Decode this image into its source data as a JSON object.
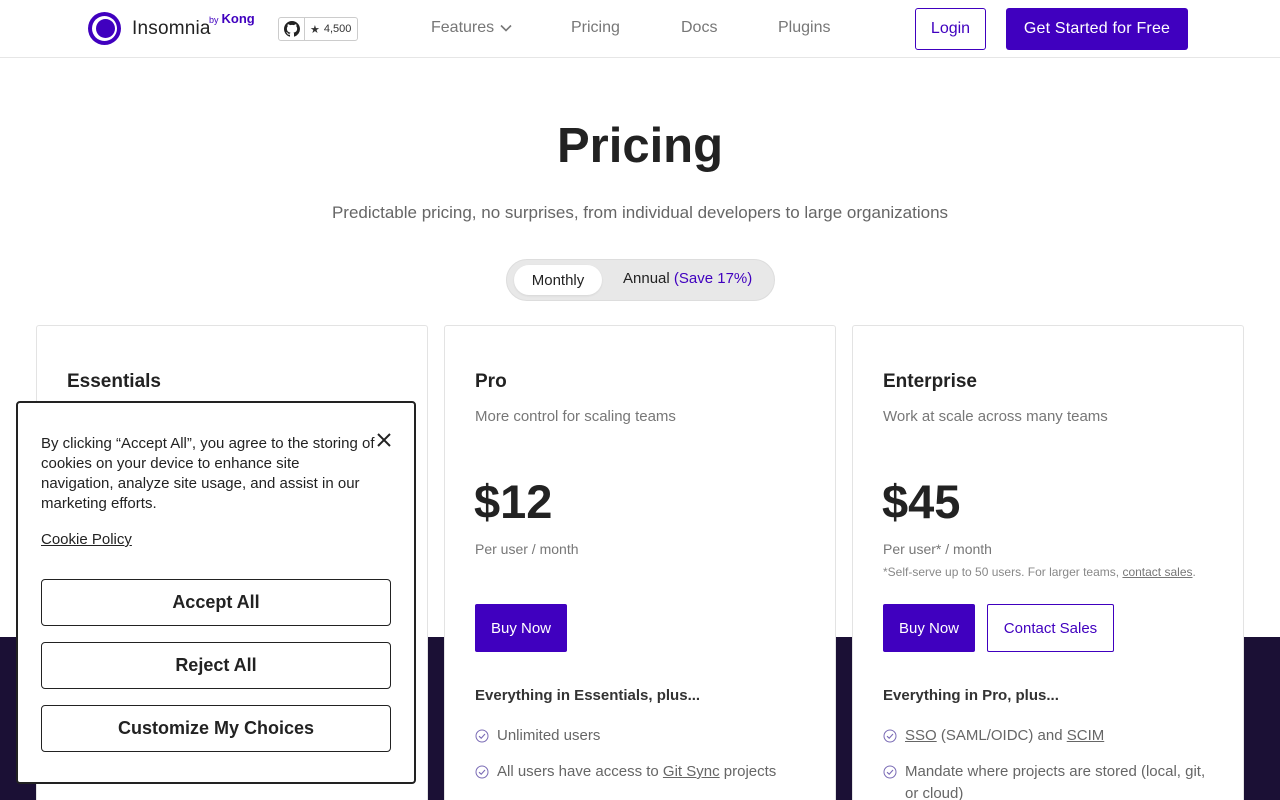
{
  "header": {
    "brand": "Insomnia",
    "brand_by": "by",
    "brand_kong": "Kong",
    "github_stars": "4,500",
    "nav": {
      "features": "Features",
      "pricing": "Pricing",
      "docs": "Docs",
      "plugins": "Plugins"
    },
    "login_label": "Login",
    "get_started_label": "Get Started for Free"
  },
  "hero": {
    "title": "Pricing",
    "subtitle": "Predictable pricing, no surprises, from individual developers to large organizations",
    "toggle": {
      "monthly": "Monthly",
      "annual": "Annual",
      "save": "(Save 17%)"
    }
  },
  "plans": {
    "essentials": {
      "name": "Essentials"
    },
    "pro": {
      "name": "Pro",
      "desc": "More control for scaling teams",
      "price": "$12",
      "per": "Per user / month",
      "buy_label": "Buy Now",
      "plus": "Everything in Essentials, plus...",
      "features": {
        "f1": "Unlimited users",
        "f2_pre": "All users have access to",
        "f2_link": "Git Sync",
        "f2_post": "projects"
      }
    },
    "enterprise": {
      "name": "Enterprise",
      "desc": "Work at scale across many teams",
      "price": "$45",
      "per": "Per user* / month",
      "note_pre": "*Self-serve up to 50 users. For larger teams,",
      "note_link": "contact sales",
      "note_post": ".",
      "buy_label": "Buy Now",
      "contact_label": "Contact Sales",
      "plus": "Everything in Pro, plus...",
      "features": {
        "f1_link1": "SSO",
        "f1_mid": "(SAML/OIDC) and",
        "f1_link2": "SCIM",
        "f2": "Mandate where projects are stored (local, git, or cloud)"
      }
    }
  },
  "cookie": {
    "text": "By clicking “Accept All”, you agree to the storing of cookies on your device to enhance site navigation, analyze site usage, and assist in our marketing efforts.",
    "policy_label": "Cookie Policy",
    "accept_label": "Accept All",
    "reject_label": "Reject All",
    "customize_label": "Customize My Choices"
  },
  "colors": {
    "brand": "#4000bf",
    "dark_band": "#1b1035"
  },
  "icons": {
    "logo": "insomnia-logo-icon",
    "github": "github-icon",
    "star": "star-icon",
    "chevron": "chevron-down-icon",
    "check": "check-circle-icon",
    "close": "close-icon"
  }
}
